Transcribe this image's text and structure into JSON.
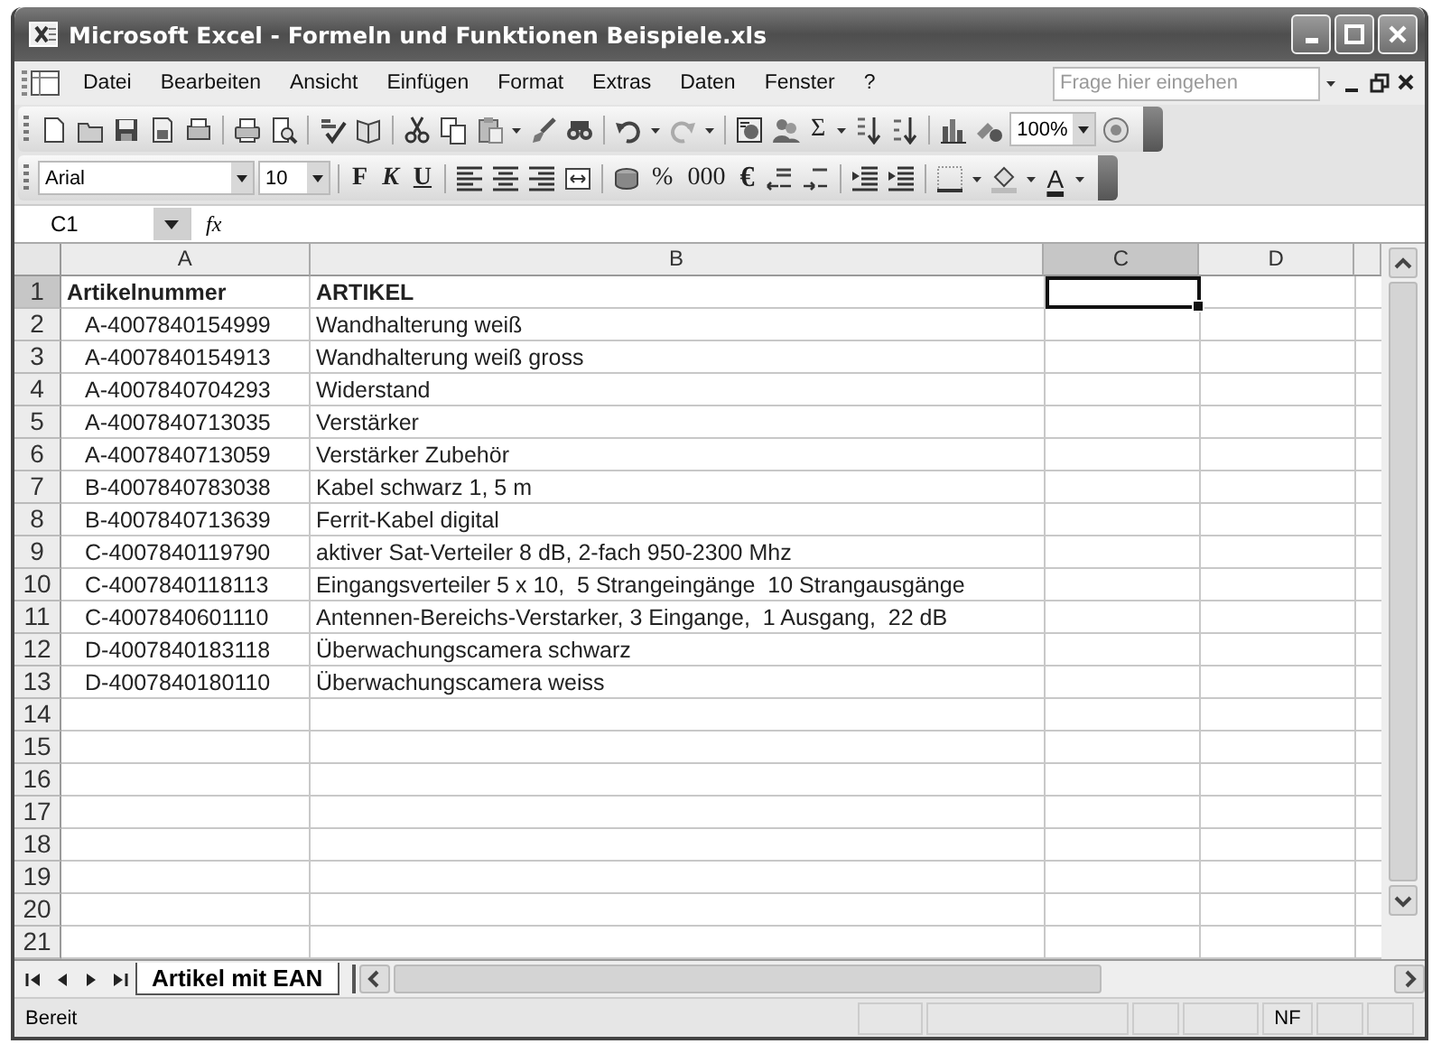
{
  "window": {
    "title": "Microsoft Excel - Formeln und Funktionen Beispiele.xls"
  },
  "menu": [
    "Datei",
    "Bearbeiten",
    "Ansicht",
    "Einfügen",
    "Format",
    "Extras",
    "Daten",
    "Fenster",
    "?"
  ],
  "help_search": {
    "placeholder": "Frage hier eingehen"
  },
  "standard_toolbar": [
    {
      "kind": "new"
    },
    {
      "kind": "open"
    },
    {
      "kind": "save"
    },
    {
      "kind": "permission"
    },
    {
      "kind": "email"
    },
    {
      "kind": "sep"
    },
    {
      "kind": "print"
    },
    {
      "kind": "preview"
    },
    {
      "kind": "sep"
    },
    {
      "kind": "spelling"
    },
    {
      "kind": "research"
    },
    {
      "kind": "sep"
    },
    {
      "kind": "cut"
    },
    {
      "kind": "copy"
    },
    {
      "kind": "paste"
    },
    {
      "kind": "caret"
    },
    {
      "kind": "brush"
    },
    {
      "kind": "camera"
    },
    {
      "kind": "sep"
    },
    {
      "kind": "undo"
    },
    {
      "kind": "caret"
    },
    {
      "kind": "redo"
    },
    {
      "kind": "caret"
    },
    {
      "kind": "sep"
    },
    {
      "kind": "hyperlink"
    },
    {
      "kind": "people"
    },
    {
      "kind": "text",
      "label": "Σ"
    },
    {
      "kind": "caret"
    },
    {
      "kind": "sortasc"
    },
    {
      "kind": "sortdesc"
    },
    {
      "kind": "sep"
    },
    {
      "kind": "chart"
    },
    {
      "kind": "drawing"
    },
    {
      "kind": "field",
      "label": "100%"
    },
    {
      "kind": "help"
    }
  ],
  "formatting_toolbar": [
    {
      "kind": "field",
      "label": "Arial"
    },
    {
      "kind": "field",
      "label": "10"
    },
    {
      "kind": "sep"
    },
    {
      "kind": "bold",
      "label": "F"
    },
    {
      "kind": "italic",
      "label": "K"
    },
    {
      "kind": "underline",
      "label": "U"
    },
    {
      "kind": "sep"
    },
    {
      "kind": "alignleft"
    },
    {
      "kind": "aligncenter"
    },
    {
      "kind": "alignright"
    },
    {
      "kind": "merge"
    },
    {
      "kind": "sep"
    },
    {
      "kind": "currency"
    },
    {
      "kind": "text",
      "label": "%"
    },
    {
      "kind": "text",
      "label": "000"
    },
    {
      "kind": "euro",
      "label": "€"
    },
    {
      "kind": "incdec"
    },
    {
      "kind": "decdec"
    },
    {
      "kind": "sep"
    },
    {
      "kind": "outdent"
    },
    {
      "kind": "indent"
    },
    {
      "kind": "sep"
    },
    {
      "kind": "borders"
    },
    {
      "kind": "caret"
    },
    {
      "kind": "fill"
    },
    {
      "kind": "caret"
    },
    {
      "kind": "fontcolor",
      "label": "A"
    },
    {
      "kind": "caret"
    }
  ],
  "formula_bar": {
    "name_box": "C1",
    "function_label": "fx"
  },
  "columns": [
    {
      "label": "A",
      "selected": false
    },
    {
      "label": "B",
      "selected": false
    },
    {
      "label": "C",
      "selected": true
    },
    {
      "label": "D",
      "selected": false
    }
  ],
  "rows": [
    {
      "number": "1",
      "selected": true,
      "kind": "header",
      "cells": [
        "Artikelnummer",
        "ARTIKEL"
      ]
    },
    {
      "number": "2",
      "selected": false,
      "cells": [
        "A-4007840154999",
        "Wandhalterung weiß"
      ]
    },
    {
      "number": "3",
      "selected": false,
      "cells": [
        "A-4007840154913",
        "Wandhalterung weiß gross"
      ]
    },
    {
      "number": "4",
      "selected": false,
      "cells": [
        "A-4007840704293",
        "Widerstand"
      ]
    },
    {
      "number": "5",
      "selected": false,
      "cells": [
        "A-4007840713035",
        "Verstärker"
      ]
    },
    {
      "number": "6",
      "selected": false,
      "cells": [
        "A-4007840713059",
        "Verstärker Zubehör"
      ]
    },
    {
      "number": "7",
      "selected": false,
      "cells": [
        "B-4007840783038",
        "Kabel schwarz 1, 5 m"
      ]
    },
    {
      "number": "8",
      "selected": false,
      "cells": [
        "B-4007840713639",
        "Ferrit-Kabel digital"
      ]
    },
    {
      "number": "9",
      "selected": false,
      "cells": [
        "C-4007840119790",
        "aktiver Sat-Verteiler 8 dB, 2-fach 950-2300 Mhz"
      ]
    },
    {
      "number": "10",
      "selected": false,
      "cells": [
        "C-4007840118113",
        "Eingangsverteiler 5 x 10,  5 Strangeingänge  10 Strangausgänge"
      ]
    },
    {
      "number": "11",
      "selected": false,
      "cells": [
        "C-4007840601110",
        "Antennen-Bereichs-Verstarker, 3 Eingange,  1 Ausgang,  22 dB"
      ]
    },
    {
      "number": "12",
      "selected": false,
      "cells": [
        "D-4007840183118",
        "Überwachungscamera schwarz"
      ]
    },
    {
      "number": "13",
      "selected": false,
      "cells": [
        "D-4007840180110",
        "Überwachungscamera weiss"
      ]
    },
    {
      "number": "14",
      "selected": false
    },
    {
      "number": "15",
      "selected": false
    },
    {
      "number": "16",
      "selected": false
    },
    {
      "number": "17",
      "selected": false
    },
    {
      "number": "18",
      "selected": false
    },
    {
      "number": "19",
      "selected": false
    },
    {
      "number": "20",
      "selected": false
    },
    {
      "number": "21",
      "selected": false
    }
  ],
  "sheet_tabs": [
    {
      "label": "Artikel mit EAN",
      "selected": true
    }
  ],
  "status_bar": {
    "text": "Bereit",
    "indicator": "NF"
  }
}
